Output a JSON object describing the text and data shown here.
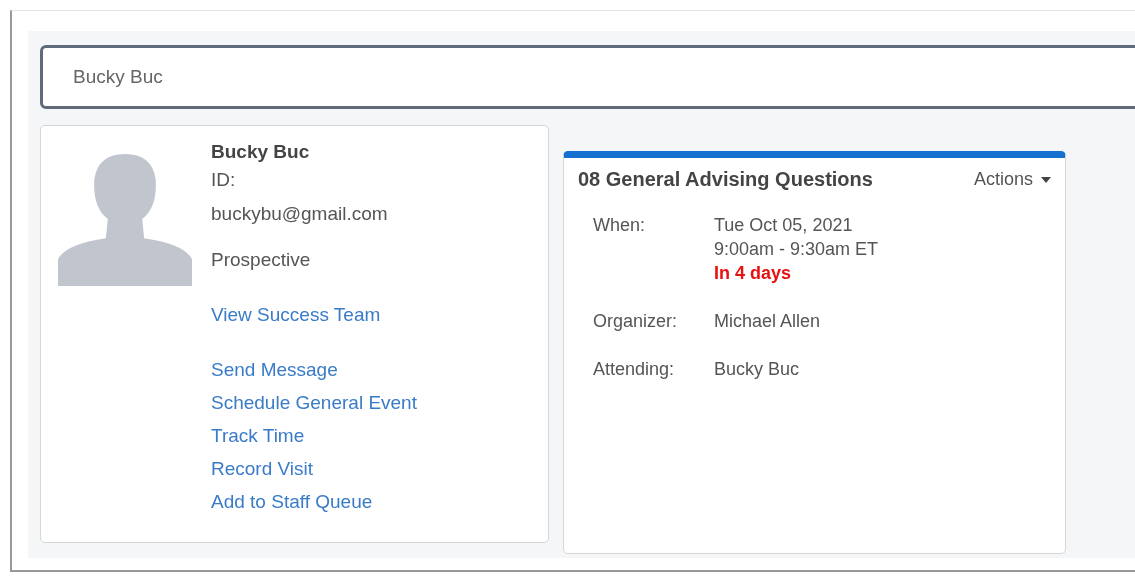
{
  "search": {
    "value": "Bucky Buc"
  },
  "profile": {
    "name": "Bucky Buc",
    "id_label": "ID:",
    "email": "buckybu@gmail.com",
    "status": "Prospective",
    "team_link": "View Success Team",
    "actions": [
      "Send Message",
      "Schedule General Event",
      "Track Time",
      "Record Visit",
      "Add to Staff Queue"
    ]
  },
  "appointment": {
    "title": "08 General Advising Questions",
    "actions_menu": "Actions",
    "details": [
      {
        "label": "When:",
        "lines": [
          "Tue Oct 05, 2021",
          "9:00am - 9:30am ET"
        ],
        "highlight": "In 4 days"
      },
      {
        "label": "Organizer:",
        "lines": [
          "Michael Allen"
        ]
      },
      {
        "label": "Attending:",
        "lines": [
          "Bucky Buc"
        ]
      }
    ]
  }
}
